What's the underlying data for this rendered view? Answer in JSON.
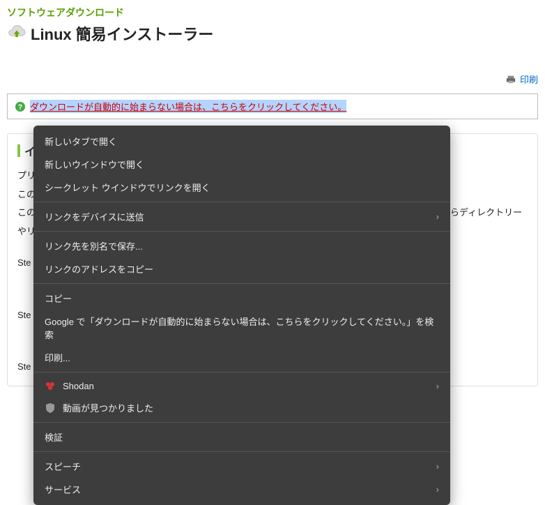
{
  "breadcrumb": "ソフトウェアダウンロード",
  "title": "Linux 簡易インストーラー",
  "print_label": "印刷",
  "notice": "ダウンロードが自動的に始まらない場合は、こちらをクリックしてください。",
  "section": {
    "title_fragment": "イ",
    "body_p1": "プリ",
    "body_p2": "この",
    "body_p3_left": "この",
    "body_p3_right": "らディレクトリー",
    "body_p4": "やリ",
    "step1": "Ste",
    "step2": "Ste",
    "step3": "Ste"
  },
  "context_menu": {
    "items": [
      {
        "label": "新しいタブで開く",
        "type": "plain"
      },
      {
        "label": "新しいウインドウで開く",
        "type": "plain"
      },
      {
        "label": "シークレット ウインドウでリンクを開く",
        "type": "plain"
      },
      {
        "sep": true
      },
      {
        "label": "リンクをデバイスに送信",
        "type": "submenu"
      },
      {
        "sep": true
      },
      {
        "label": "リンク先を別名で保存...",
        "type": "plain"
      },
      {
        "label": "リンクのアドレスをコピー",
        "type": "plain"
      },
      {
        "sep": true
      },
      {
        "label": "コピー",
        "type": "plain"
      },
      {
        "label": "Google で「ダウンロードが自動的に始まらない場合は、こちらをクリックしてください。」を検索",
        "type": "plain"
      },
      {
        "label": "印刷...",
        "type": "plain"
      },
      {
        "sep": true
      },
      {
        "label": "Shodan",
        "type": "submenu",
        "icon": "shodan"
      },
      {
        "label": "動画が見つかりました",
        "type": "plain",
        "icon": "shield"
      },
      {
        "sep": true
      },
      {
        "label": "検証",
        "type": "plain"
      },
      {
        "sep": true
      },
      {
        "label": "スピーチ",
        "type": "submenu"
      },
      {
        "label": "サービス",
        "type": "submenu"
      }
    ]
  }
}
